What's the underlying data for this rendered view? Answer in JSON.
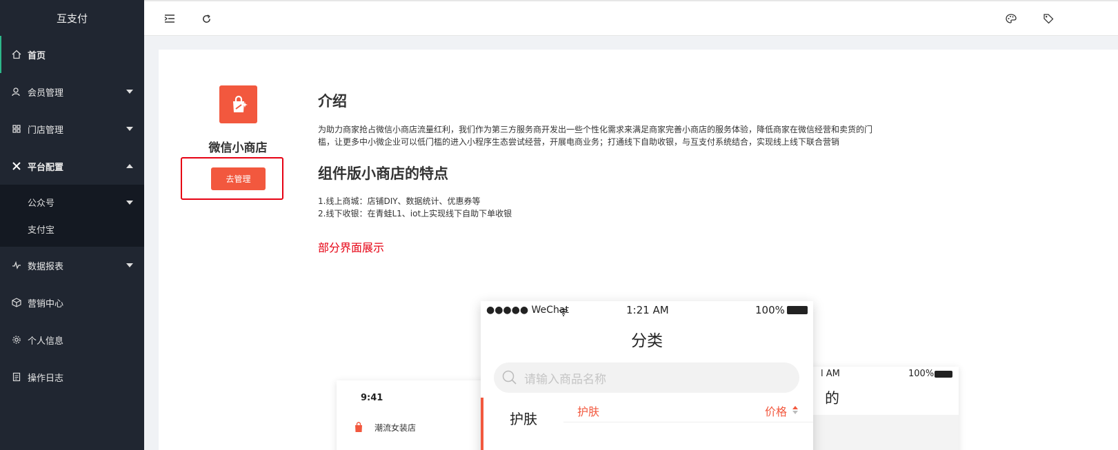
{
  "app": {
    "title": "互支付"
  },
  "sidebar": {
    "items": [
      {
        "label": "首页",
        "icon": "home-icon"
      },
      {
        "label": "会员管理",
        "icon": "member-icon"
      },
      {
        "label": "门店管理",
        "icon": "store-icon"
      },
      {
        "label": "平台配置",
        "icon": "config-icon"
      },
      {
        "label": "数据报表",
        "icon": "report-icon"
      },
      {
        "label": "营销中心",
        "icon": "cube-icon"
      },
      {
        "label": "个人信息",
        "icon": "gear-icon"
      },
      {
        "label": "操作日志",
        "icon": "log-icon"
      }
    ],
    "submenu": [
      {
        "label": "公众号"
      },
      {
        "label": "支付宝"
      }
    ]
  },
  "toolbar": {
    "collapse_icon": "indent-icon",
    "refresh_icon": "refresh-icon",
    "theme_icon": "palette-icon",
    "tag_icon": "tag-icon"
  },
  "product": {
    "name": "微信小商店",
    "manage_label": "去管理",
    "intro_title": "介绍",
    "intro_line1": "为助力商家抢占微信小商店流量红利，我们作为第三方服务商开发出一些个性化需求来满足商家完善小商店的服务体验，降低商家在微信经营和卖货的门",
    "intro_line2": "槛，让更多中小微企业可以低门槛的进入小程序生态尝试经营，开展电商业务；打通线下自助收银，与互支付系统结合，实现线上线下联合营销",
    "features_title": "组件版小商店的特点",
    "feature1": "1.线上商城：店铺DIY、数据统计、优惠券等",
    "feature2": "2.线下收银：在青蛙L1、iot上实现线下自助下单收银",
    "preview_title": "部分界面展示"
  },
  "preview": {
    "left": {
      "time": "9:41",
      "shop": "潮流女装店"
    },
    "center": {
      "carrier": "●●●●● WeChat",
      "time": "1:21 AM",
      "battery": "100%",
      "page_title": "分类",
      "search_placeholder": "请输入商品名称",
      "category": "护肤",
      "tab_category": "护肤",
      "tab_price": "价格"
    },
    "right": {
      "time": "l AM",
      "battery": "100%",
      "title_fragment": "的"
    }
  },
  "colors": {
    "accent": "#f2583e",
    "sidebar_bg": "#202631",
    "active_bar": "#2db88a",
    "highlight": "#e60012"
  }
}
